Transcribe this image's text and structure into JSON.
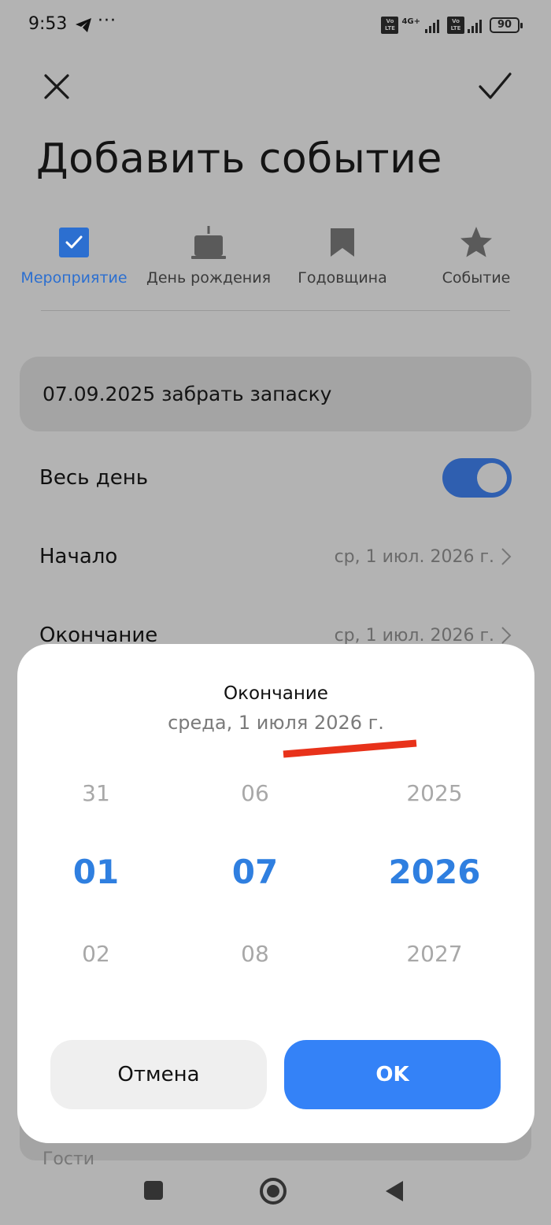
{
  "status_bar": {
    "time": "9:53",
    "dots": "···",
    "network": "4G+",
    "volte_label": "Vo LTE",
    "battery": "90"
  },
  "header": {
    "title": "Добавить событие"
  },
  "tabs": [
    {
      "label": "Мероприятие",
      "icon": "checkbox-icon",
      "active": true
    },
    {
      "label": "День рождения",
      "icon": "cake-icon",
      "active": false
    },
    {
      "label": "Годовщина",
      "icon": "bookmark-icon",
      "active": false
    },
    {
      "label": "Событие",
      "icon": "star-icon",
      "active": false
    }
  ],
  "form": {
    "title_value": "07.09.2025 забрать запаску",
    "all_day_label": "Весь день",
    "all_day_on": true,
    "start_label": "Начало",
    "start_value": "ср, 1 июл. 2026 г.",
    "end_label": "Окончание",
    "end_value": "ср, 1 июл. 2026 г.",
    "guests_label": "Гости"
  },
  "dialog": {
    "title": "Окончание",
    "subtitle": "среда, 1 июля 2026 г.",
    "day": {
      "prev": "31",
      "selected": "01",
      "next": "02"
    },
    "month": {
      "prev": "06",
      "selected": "07",
      "next": "08"
    },
    "year": {
      "prev": "2025",
      "selected": "2026",
      "next": "2027"
    },
    "cancel_label": "Отмена",
    "ok_label": "OK"
  },
  "colors": {
    "accent": "#3482f7",
    "selected_text": "#2f7fe0",
    "annotation": "#e8321a",
    "toggle_on": "#2f5fb0"
  }
}
